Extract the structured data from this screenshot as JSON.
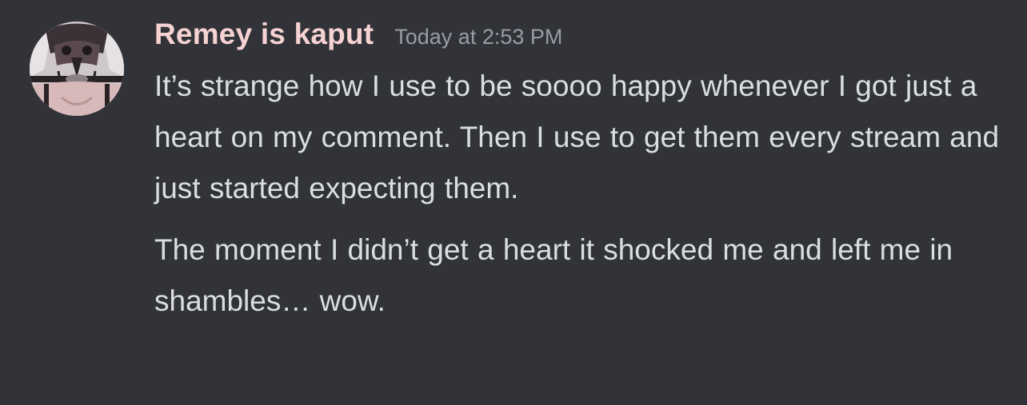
{
  "message": {
    "username": "Remey is kaput",
    "timestamp": "Today at 2:53 PM",
    "paragraphs": [
      "It’s strange how I use to be soooo happy whenever I got just a heart on my comment. Then I use to get them every stream and just started expecting them.",
      "The moment I didn’t get a heart it shocked me and left me in shambles… wow."
    ],
    "avatar_icon": "user-avatar-icon"
  },
  "colors": {
    "background": "#313338",
    "username": "#f6d2d2",
    "timestamp": "#9a9ca4",
    "text": "#dbdee1"
  }
}
